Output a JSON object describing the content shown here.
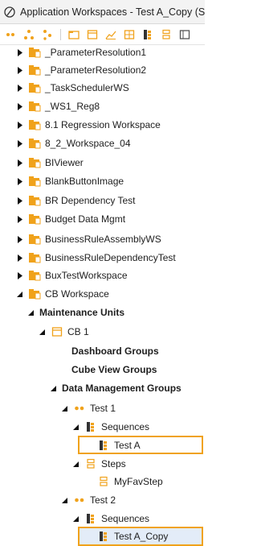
{
  "window": {
    "title": "Application Workspaces - Test A_Copy (Sequ"
  },
  "toolbar": {
    "icons": [
      "dots-icon",
      "hierarchy-icon",
      "tree-icon",
      "separator",
      "folder-icon",
      "window-icon",
      "chart-icon",
      "grid-icon",
      "sequence-icon",
      "step-icon",
      "panel-icon"
    ]
  },
  "tree": {
    "items": [
      {
        "label": "_ParameterResolution1",
        "type": "workspace"
      },
      {
        "label": "_ParameterResolution2",
        "type": "workspace"
      },
      {
        "label": "_TaskSchedulerWS",
        "type": "workspace"
      },
      {
        "label": "_WS1_Reg8",
        "type": "workspace"
      },
      {
        "label": "8.1 Regression Workspace",
        "type": "workspace"
      },
      {
        "label": "8_2_Workspace_04",
        "type": "workspace"
      },
      {
        "label": "BIViewer",
        "type": "workspace"
      },
      {
        "label": "BlankButtonImage",
        "type": "workspace"
      },
      {
        "label": "BR Dependency Test",
        "type": "workspace"
      },
      {
        "label": "Budget Data Mgmt",
        "type": "workspace"
      },
      {
        "label": "BusinessRuleAssemblyWS",
        "type": "workspace"
      },
      {
        "label": "BusinessRuleDependencyTest",
        "type": "workspace"
      },
      {
        "label": "BuxTestWorkspace",
        "type": "workspace"
      },
      {
        "label": "CB Workspace",
        "type": "workspace-open"
      },
      {
        "label": "Maintenance Units",
        "type": "group"
      },
      {
        "label": "CB 1",
        "type": "unit"
      },
      {
        "label": "Dashboard Groups",
        "type": "group"
      },
      {
        "label": "Cube View Groups",
        "type": "group"
      },
      {
        "label": "Data Management Groups",
        "type": "group"
      },
      {
        "label": "Test 1",
        "type": "dm-group"
      },
      {
        "label": "Sequences",
        "type": "sequences"
      },
      {
        "label": "Test A",
        "type": "sequence"
      },
      {
        "label": "Steps",
        "type": "steps"
      },
      {
        "label": "MyFavStep",
        "type": "step"
      },
      {
        "label": "Test 2",
        "type": "dm-group"
      },
      {
        "label": "Sequences",
        "type": "sequences"
      },
      {
        "label": "Test A_Copy",
        "type": "sequence"
      }
    ]
  },
  "colors": {
    "highlight": "#f0a21b",
    "workspace_icon": "#f0a21b",
    "selection": "#e3ecf8"
  }
}
